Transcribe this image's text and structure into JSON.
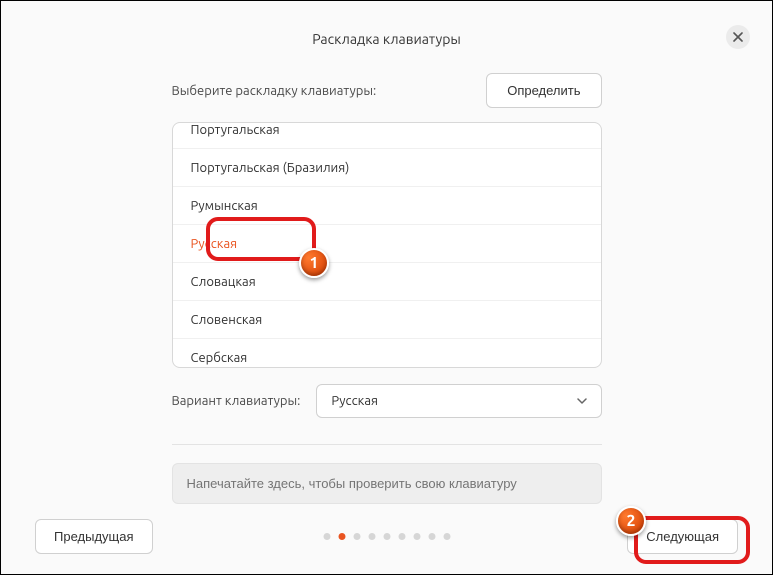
{
  "title": "Раскладка клавиатуры",
  "prompt": "Выберите раскладку клавиатуры:",
  "detect_label": "Определить",
  "layouts": [
    "Португальская",
    "Португальская (Бразилия)",
    "Румынская",
    "Русская",
    "Словацкая",
    "Словенская",
    "Сербская"
  ],
  "selected_index": 3,
  "variant_label": "Вариант клавиатуры:",
  "variant_value": "Русская",
  "test_placeholder": "Напечатайте здесь, чтобы проверить свою клавиатуру",
  "nav": {
    "prev": "Предыдущая",
    "next": "Следующая"
  },
  "pager": {
    "count": 9,
    "active": 1
  },
  "annotations": {
    "badge1": "1",
    "badge2": "2"
  }
}
